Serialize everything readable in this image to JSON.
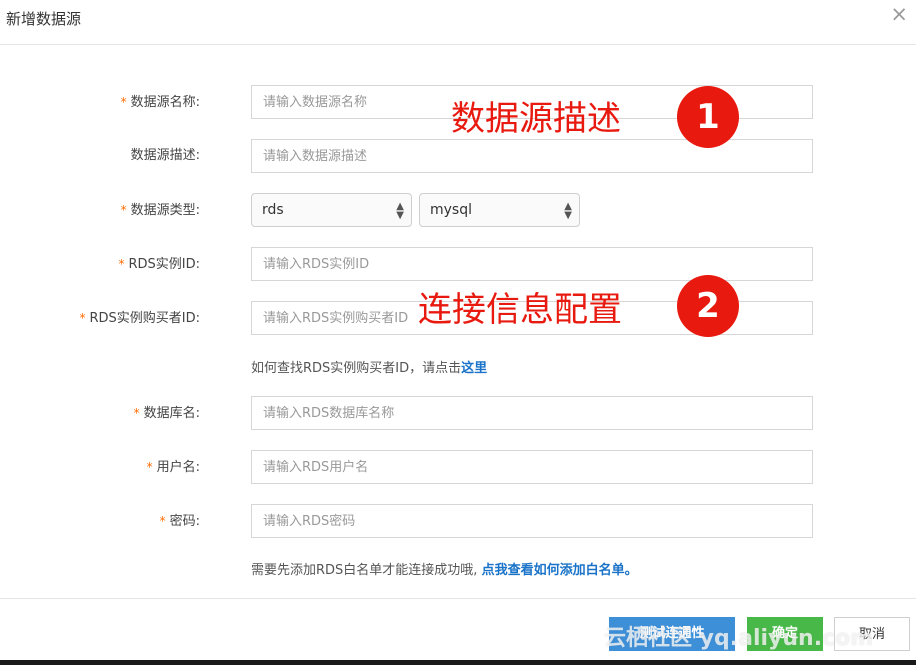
{
  "dialog": {
    "title": "新增数据源",
    "close_glyph": "×"
  },
  "form": {
    "name": {
      "label": "数据源名称:",
      "placeholder": "请输入数据源名称",
      "required_mark": "*"
    },
    "desc": {
      "label": "数据源描述:",
      "placeholder": "请输入数据源描述"
    },
    "type": {
      "label": "数据源类型:",
      "required_mark": "*",
      "select1_value": "rds",
      "select2_value": "mysql"
    },
    "instance": {
      "label": "RDS实例ID:",
      "placeholder": "请输入RDS实例ID",
      "required_mark": "*"
    },
    "buyer": {
      "label": "RDS实例购买者ID:",
      "placeholder": "请输入RDS实例购买者ID",
      "required_mark": "*"
    },
    "buyer_help": {
      "text": "如何查找RDS实例购买者ID，请点击",
      "link": "这里"
    },
    "database": {
      "label": "数据库名:",
      "placeholder": "请输入RDS数据库名称",
      "required_mark": "*"
    },
    "username": {
      "label": "用户名:",
      "placeholder": "请输入RDS用户名",
      "required_mark": "*"
    },
    "password": {
      "label": "密码:",
      "placeholder": "请输入RDS密码",
      "required_mark": "*"
    },
    "whitelist_help": {
      "text": "需要先添加RDS白名单才能连接成功哦, ",
      "link": "点我查看如何添加白名单。"
    }
  },
  "annotations": [
    {
      "text": "数据源描述",
      "badge": "1"
    },
    {
      "text": "连接信息配置",
      "badge": "2"
    }
  ],
  "footer": {
    "test_label": "测试连通性",
    "ok_label": "确定",
    "cancel_label": "取消"
  },
  "watermark": "云栖社区 yq.aliyun.com",
  "colors": {
    "required": "#ff6a00",
    "link": "#1a73c8",
    "annotation": "#e8190f",
    "test_btn": "#3d8fd8",
    "ok_btn": "#48b848"
  }
}
